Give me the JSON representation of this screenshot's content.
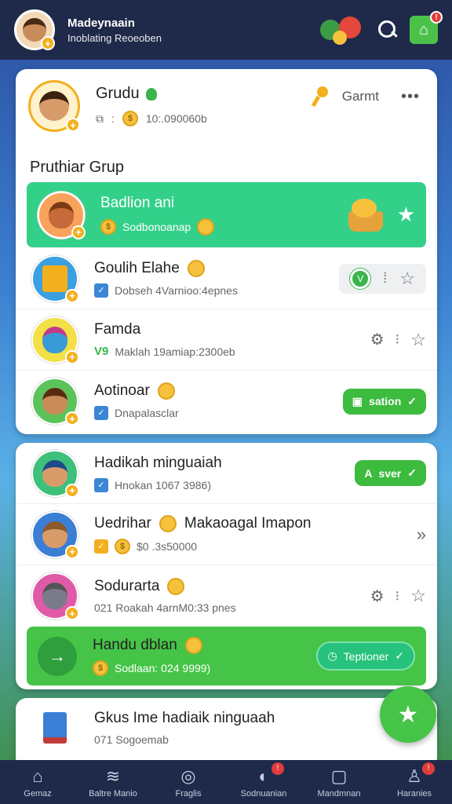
{
  "header": {
    "user_name": "Madeynaain",
    "user_status": "Inoblating Reoeoben",
    "store_badge": "!"
  },
  "group": {
    "title": "Grudu",
    "coins": "10:.090060b",
    "right_label": "Garmt",
    "more": "•••"
  },
  "section1_title": "Pruthiar Grup",
  "list1": [
    {
      "name": "Badlion ani",
      "sub": "Sodbonoanap"
    },
    {
      "name": "Goulih Elahe",
      "sub": "Dobseh 4Varnioo:4epnes"
    },
    {
      "name": "Famda",
      "tag": "V9",
      "sub": "Maklah 19amiap:2300eb"
    },
    {
      "name": "Aotinoar",
      "sub": "Dnapalasclar",
      "button": "sation"
    }
  ],
  "list2": [
    {
      "name": "Hadikah minguaiah",
      "sub": "Hnokan 1067 3986)",
      "button": "sver"
    },
    {
      "name": "Uedrihar",
      "name2": "Makaoagal Imapon",
      "sub": "$0 .3s50000"
    },
    {
      "name": "Sodurarta",
      "sub": "021 Roakah 4arnM0:33 pnes"
    },
    {
      "name": "Handu dblan",
      "sub": "Sodlaan: 024 9999)",
      "button": "Teptioner"
    }
  ],
  "card3": {
    "name": "Gkus Ime hadiaik ninguaah",
    "sub": "071 Sogoemab"
  },
  "bottom_nav": [
    {
      "label": "Gemaz"
    },
    {
      "label": "Baltre Manio"
    },
    {
      "label": "Fraglis"
    },
    {
      "label": "Sodnuanian",
      "badge": "!"
    },
    {
      "label": "Mandmnan"
    },
    {
      "label": "Haranies",
      "badge": "!"
    }
  ],
  "colors": {
    "topbar": "#1f2a4a",
    "accent_green": "#46c448",
    "highlight_teal": "#33d08a",
    "coin_gold": "#f6c23e"
  }
}
